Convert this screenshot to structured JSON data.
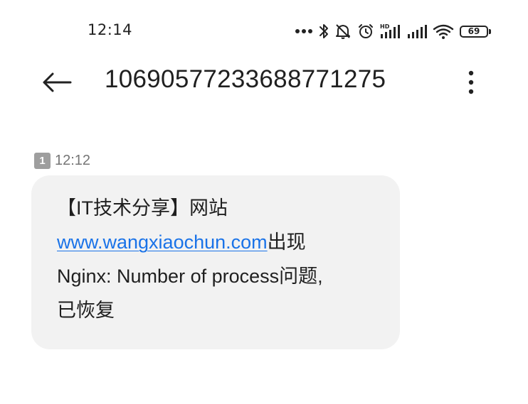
{
  "status_bar": {
    "time": "12:14",
    "battery_level": "69",
    "icons": [
      "more-notifications-icon",
      "bluetooth-icon",
      "mute-icon",
      "alarm-icon",
      "hd-signal-icon",
      "signal-icon",
      "wifi-icon",
      "battery-icon"
    ]
  },
  "header": {
    "sender": "10690577233688771275",
    "back_icon": "arrow-left-icon",
    "menu_icon": "more-vertical-icon"
  },
  "message": {
    "sim": "1",
    "time": "12:12",
    "line1": "【IT技术分享】网站",
    "link": "www.wangxiaochun.com",
    "line2_suffix": "出现",
    "line3": "Nginx: Number of process问题,",
    "line4": "已恢复"
  }
}
